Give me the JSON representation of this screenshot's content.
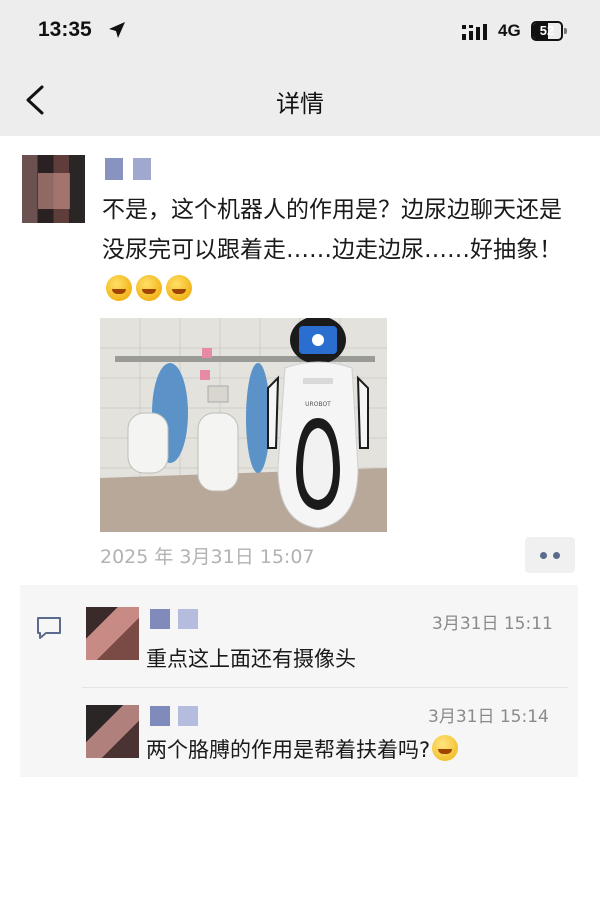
{
  "status": {
    "time": "13:35",
    "network": "4G",
    "battery": "52",
    "battery_level": 0.52
  },
  "nav": {
    "back_icon": "chevron-left-icon",
    "title": "详情"
  },
  "post": {
    "text": "不是，这个机器人的作用是？边尿边聊天还是没尿完可以跟着走……边走边尿……好抽象！",
    "emoji_count": 3,
    "time": "2025 年 3月31日 15:07",
    "robot_brand": "UROBOT"
  },
  "comments": [
    {
      "time": "3月31日 15:11",
      "text": "重点这上面还有摄像头"
    },
    {
      "time": "3月31日 15:14",
      "text": "两个胳膊的作用是帮着扶着吗?"
    }
  ],
  "colors": {
    "bar_bg": "#ededed",
    "comment_bg": "#f6f6f6",
    "link_blue": "#5a6b8c"
  }
}
